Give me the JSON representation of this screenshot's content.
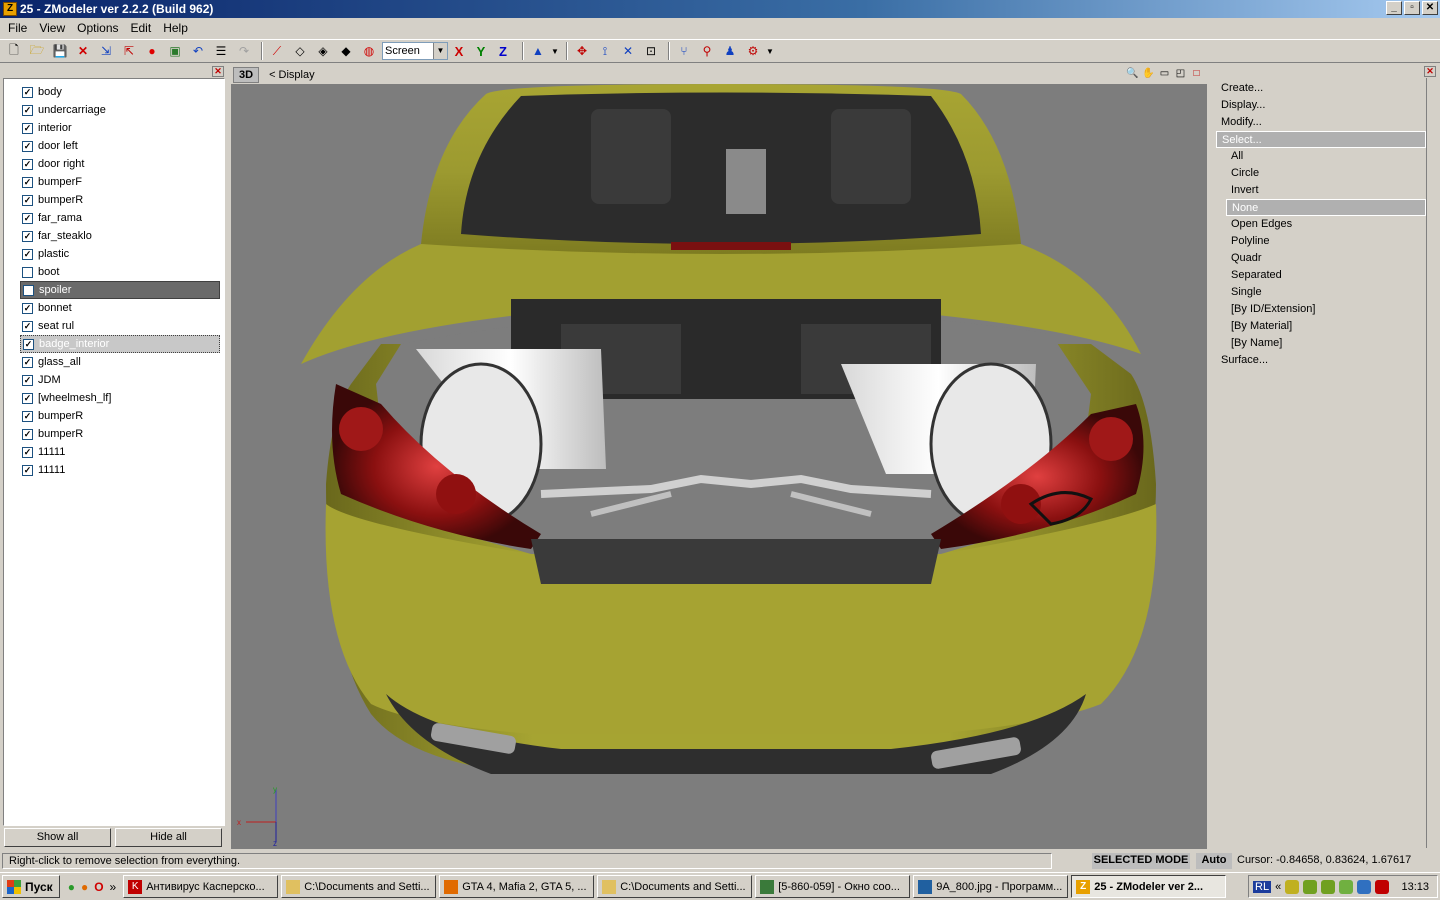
{
  "window": {
    "title": "25 - ZModeler ver 2.2.2 (Build 962)",
    "app_icon_letter": "Z",
    "buttons": [
      "_",
      "▫",
      "✕"
    ]
  },
  "menu": [
    "File",
    "View",
    "Options",
    "Edit",
    "Help"
  ],
  "toolbar": {
    "coord_mode": "Screen",
    "axes": [
      {
        "label": "X",
        "color": "#cc0000"
      },
      {
        "label": "Y",
        "color": "#008000"
      },
      {
        "label": "Z",
        "color": "#0000cc"
      }
    ]
  },
  "objects": [
    {
      "name": "body",
      "checked": true
    },
    {
      "name": "undercarriage",
      "checked": true
    },
    {
      "name": "interior",
      "checked": true
    },
    {
      "name": "door left",
      "checked": true
    },
    {
      "name": "door right",
      "checked": true
    },
    {
      "name": "bumperF",
      "checked": true
    },
    {
      "name": "bumperR",
      "checked": true
    },
    {
      "name": "far_rama",
      "checked": true
    },
    {
      "name": "far_steaklo",
      "checked": true
    },
    {
      "name": "plastic",
      "checked": true
    },
    {
      "name": "boot",
      "checked": false
    },
    {
      "name": "spoiler",
      "checked": false,
      "state": "selected"
    },
    {
      "name": "bonnet",
      "checked": true
    },
    {
      "name": "seat rul",
      "checked": true
    },
    {
      "name": "badge_interior",
      "checked": true,
      "state": "focused"
    },
    {
      "name": "glass_all",
      "checked": true
    },
    {
      "name": "JDM",
      "checked": true
    },
    {
      "name": "[wheelmesh_lf]",
      "checked": true
    },
    {
      "name": "bumperR",
      "checked": true
    },
    {
      "name": "bumperR",
      "checked": true
    },
    {
      "name": "11111",
      "checked": true
    },
    {
      "name": "11111",
      "checked": true
    }
  ],
  "left_buttons": {
    "show_all": "Show all",
    "hide_all": "Hide all"
  },
  "viewport": {
    "tag": "3D",
    "label": "<  Display"
  },
  "commands": [
    {
      "label": "Create...",
      "level": 0
    },
    {
      "label": "Display...",
      "level": 0
    },
    {
      "label": "Modify...",
      "level": 0
    },
    {
      "label": "Select...",
      "level": 0,
      "highlight": true
    },
    {
      "label": "All",
      "level": 1
    },
    {
      "label": "Circle",
      "level": 1
    },
    {
      "label": "Invert",
      "level": 1
    },
    {
      "label": "None",
      "level": 1,
      "highlight": true
    },
    {
      "label": "Open Edges",
      "level": 1
    },
    {
      "label": "Polyline",
      "level": 1
    },
    {
      "label": "Quadr",
      "level": 1
    },
    {
      "label": "Separated",
      "level": 1
    },
    {
      "label": "Single",
      "level": 1
    },
    {
      "label": "[By ID/Extension]",
      "level": 1
    },
    {
      "label": "[By Material]",
      "level": 1
    },
    {
      "label": "[By Name]",
      "level": 1
    },
    {
      "label": "Surface...",
      "level": 0
    }
  ],
  "status": {
    "hint": "Right-click to remove selection from everything.",
    "mode": "SELECTED MODE",
    "auto": "Auto",
    "cursor": "Cursor: -0.84658, 0.83624, 1.67617"
  },
  "taskbar": {
    "start": "Пуск",
    "tasks": [
      {
        "label": "Антивирус Касперско...",
        "icon_color": "#c00000",
        "icon_letter": "K"
      },
      {
        "label": "C:\\Documents and Setti...",
        "icon_color": "#e0c060",
        "icon_letter": ""
      },
      {
        "label": "GTA 4, Mafia 2, GTA 5, ...",
        "icon_color": "#e06a00",
        "icon_letter": ""
      },
      {
        "label": "C:\\Documents and Setti...",
        "icon_color": "#e0c060",
        "icon_letter": ""
      },
      {
        "label": "[5-860-059] - Окно соо...",
        "icon_color": "#3a7a3a",
        "icon_letter": ""
      },
      {
        "label": "9A_800.jpg - Программ...",
        "icon_color": "#2060a0",
        "icon_letter": ""
      },
      {
        "label": "25 - ZModeler ver 2...",
        "icon_color": "#e8a000",
        "icon_letter": "Z",
        "active": true
      }
    ],
    "lang": "RL",
    "clock": "13:13"
  }
}
